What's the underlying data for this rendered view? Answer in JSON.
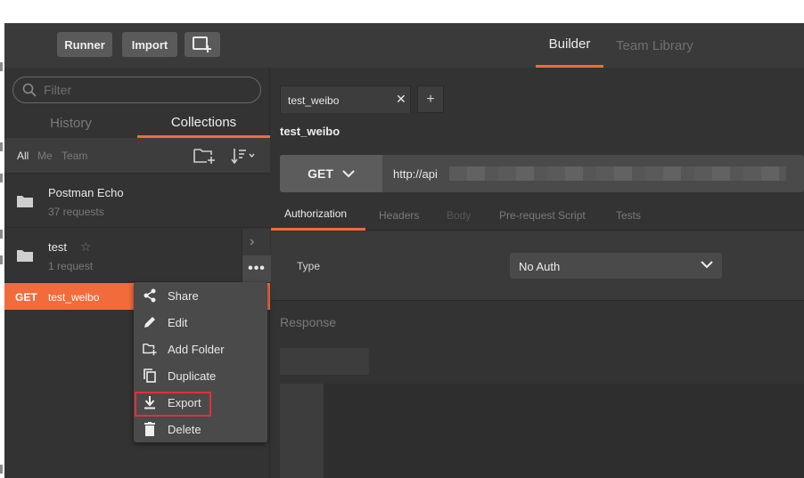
{
  "header": {
    "runner_label": "Runner",
    "import_label": "Import",
    "tabs": [
      {
        "label": "Builder",
        "active": true
      },
      {
        "label": "Team Library",
        "active": false
      }
    ]
  },
  "sidebar": {
    "filter_placeholder": "Filter",
    "tabs": [
      {
        "label": "History",
        "active": false
      },
      {
        "label": "Collections",
        "active": true
      }
    ],
    "filters": [
      "All",
      "Me",
      "Team"
    ],
    "collections": [
      {
        "name": "Postman Echo",
        "count": "37 requests"
      },
      {
        "name": "test",
        "count": "1 request"
      }
    ],
    "requests": [
      {
        "method": "GET",
        "name": "test_weibo"
      }
    ]
  },
  "context_menu": {
    "items": [
      {
        "label": "Share",
        "icon": "share-icon"
      },
      {
        "label": "Edit",
        "icon": "pencil-icon"
      },
      {
        "label": "Add Folder",
        "icon": "add-folder-icon"
      },
      {
        "label": "Duplicate",
        "icon": "duplicate-icon"
      },
      {
        "label": "Export",
        "icon": "download-icon",
        "highlighted": true
      },
      {
        "label": "Delete",
        "icon": "trash-icon"
      }
    ]
  },
  "main": {
    "open_tab": "test_weibo",
    "request_title": "test_weibo",
    "method": "GET",
    "url": "http://api",
    "request_tabs": [
      {
        "label": "Authorization",
        "active": true
      },
      {
        "label": "Headers",
        "active": false
      },
      {
        "label": "Body",
        "active": false,
        "disabled": true
      },
      {
        "label": "Pre-request Script",
        "active": false
      },
      {
        "label": "Tests",
        "active": false
      }
    ],
    "auth": {
      "type_label": "Type",
      "type_value": "No Auth"
    },
    "response_label": "Response"
  },
  "colors": {
    "accent": "#f26b3a",
    "highlight_box": "#e0303a",
    "background": "#333333"
  }
}
